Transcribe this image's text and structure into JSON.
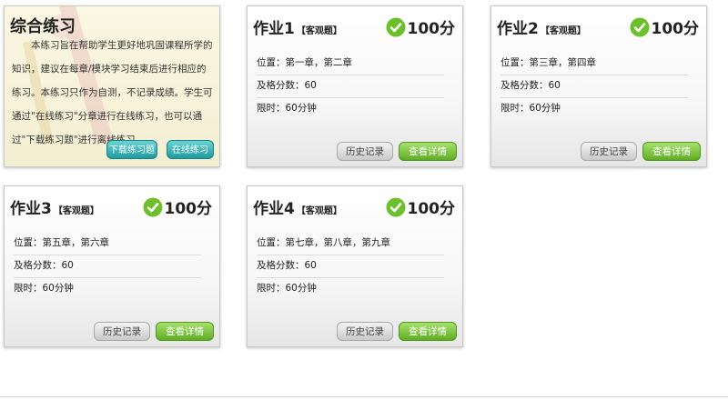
{
  "intro": {
    "title": "综合练习",
    "text": "本练习旨在帮助学生更好地巩固课程所学的知识，建议在每章/模块学习结束后进行相应的练习。本练习只作为自测，不记录成绩。学生可通过\"在线练习\"分章进行在线练习，也可以通过\"下载练习题\"进行离线练习。",
    "download_label": "下载练习题",
    "online_label": "在线练习"
  },
  "common": {
    "history_label": "历史记录",
    "details_label": "查看详情",
    "pass_label": "及格分数：",
    "limit_label": "限时：",
    "position_label": "位置：",
    "check_color": "#6cc02c"
  },
  "assignments": [
    {
      "title": "作业1",
      "type": "【客观题】",
      "score": "100分",
      "position": "第一章，第二章",
      "pass_score": "60",
      "time_limit": "60分钟"
    },
    {
      "title": "作业2",
      "type": "【客观题】",
      "score": "100分",
      "position": "第三章，第四章",
      "pass_score": "60",
      "time_limit": "60分钟"
    },
    {
      "title": "作业3",
      "type": "【客观题】",
      "score": "100分",
      "position": "第五章，第六章",
      "pass_score": "60",
      "time_limit": "60分钟"
    },
    {
      "title": "作业4",
      "type": "【客观题】",
      "score": "100分",
      "position": "第七章，第八章，第九章",
      "pass_score": "60",
      "time_limit": "60分钟"
    }
  ]
}
